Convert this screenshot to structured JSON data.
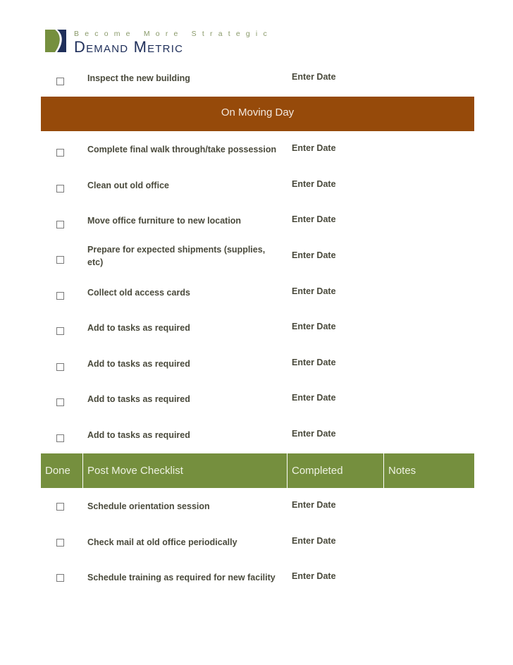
{
  "logo": {
    "tagline": "Become More Strategic",
    "brand": "Demand Metric",
    "colors": {
      "green": "#758f3e",
      "navy": "#1f2f5a"
    }
  },
  "colors": {
    "moving_day_bar": "#964a0a",
    "post_move_header": "#758f3e",
    "text": "#4a4a3c"
  },
  "pre_move_tail": [
    {
      "task": "Inspect the new building",
      "date": "Enter Date",
      "checked": false
    }
  ],
  "moving_day": {
    "title": "On Moving Day",
    "items": [
      {
        "task": "Complete final walk through/take possession",
        "date": "Enter Date",
        "checked": false
      },
      {
        "task": "Clean out old office",
        "date": "Enter Date",
        "checked": false
      },
      {
        "task": "Move office furniture to new location",
        "date": "Enter Date",
        "checked": false
      },
      {
        "task": "Prepare for expected shipments (supplies, etc)",
        "date": "Enter Date",
        "checked": false
      },
      {
        "task": "Collect old access cards",
        "date": "Enter Date",
        "checked": false
      },
      {
        "task": "Add to tasks as required",
        "date": "Enter Date",
        "checked": false
      },
      {
        "task": "Add to tasks as required",
        "date": "Enter Date",
        "checked": false
      },
      {
        "task": "Add to tasks as required",
        "date": "Enter Date",
        "checked": false
      },
      {
        "task": "Add to tasks as required",
        "date": "Enter Date",
        "checked": false
      }
    ]
  },
  "post_move": {
    "headers": {
      "done": "Done",
      "checklist": "Post Move Checklist",
      "completed": "Completed",
      "notes": "Notes"
    },
    "items": [
      {
        "task": "Schedule orientation session",
        "date": "Enter Date",
        "checked": false
      },
      {
        "task": "Check mail at old office periodically",
        "date": "Enter Date",
        "checked": false
      },
      {
        "task": "Schedule training as required for new facility",
        "date": "Enter Date",
        "checked": false
      }
    ]
  }
}
